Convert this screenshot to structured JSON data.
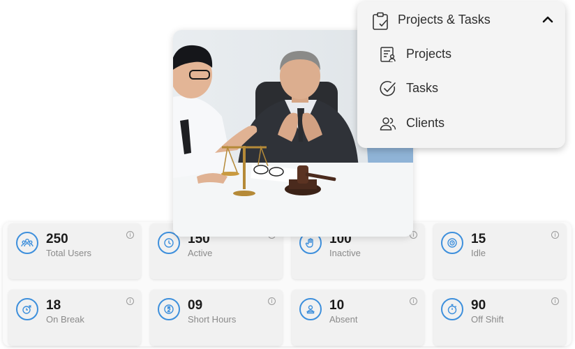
{
  "menu": {
    "title": "Projects & Tasks",
    "items": [
      {
        "label": "Projects",
        "icon": "projects-icon"
      },
      {
        "label": "Tasks",
        "icon": "check-circle-icon"
      },
      {
        "label": "Clients",
        "icon": "clients-icon"
      }
    ]
  },
  "stats": [
    {
      "value": "250",
      "label": "Total Users",
      "icon": "users-icon"
    },
    {
      "value": "150",
      "label": "Active",
      "icon": "clock-icon"
    },
    {
      "value": "100",
      "label": "Inactive",
      "icon": "hand-icon"
    },
    {
      "value": "15",
      "label": "Idle",
      "icon": "idle-icon"
    },
    {
      "value": "18",
      "label": "On Break",
      "icon": "break-icon"
    },
    {
      "value": "09",
      "label": "Short Hours",
      "icon": "hourglass-icon"
    },
    {
      "value": "10",
      "label": "Absent",
      "icon": "absent-icon"
    },
    {
      "value": "90",
      "label": "Off Shift",
      "icon": "stopwatch-icon"
    }
  ],
  "colors": {
    "accent": "#3d8fdc",
    "card_bg": "#f1f1f1",
    "menu_bg": "#f4f4f4"
  }
}
